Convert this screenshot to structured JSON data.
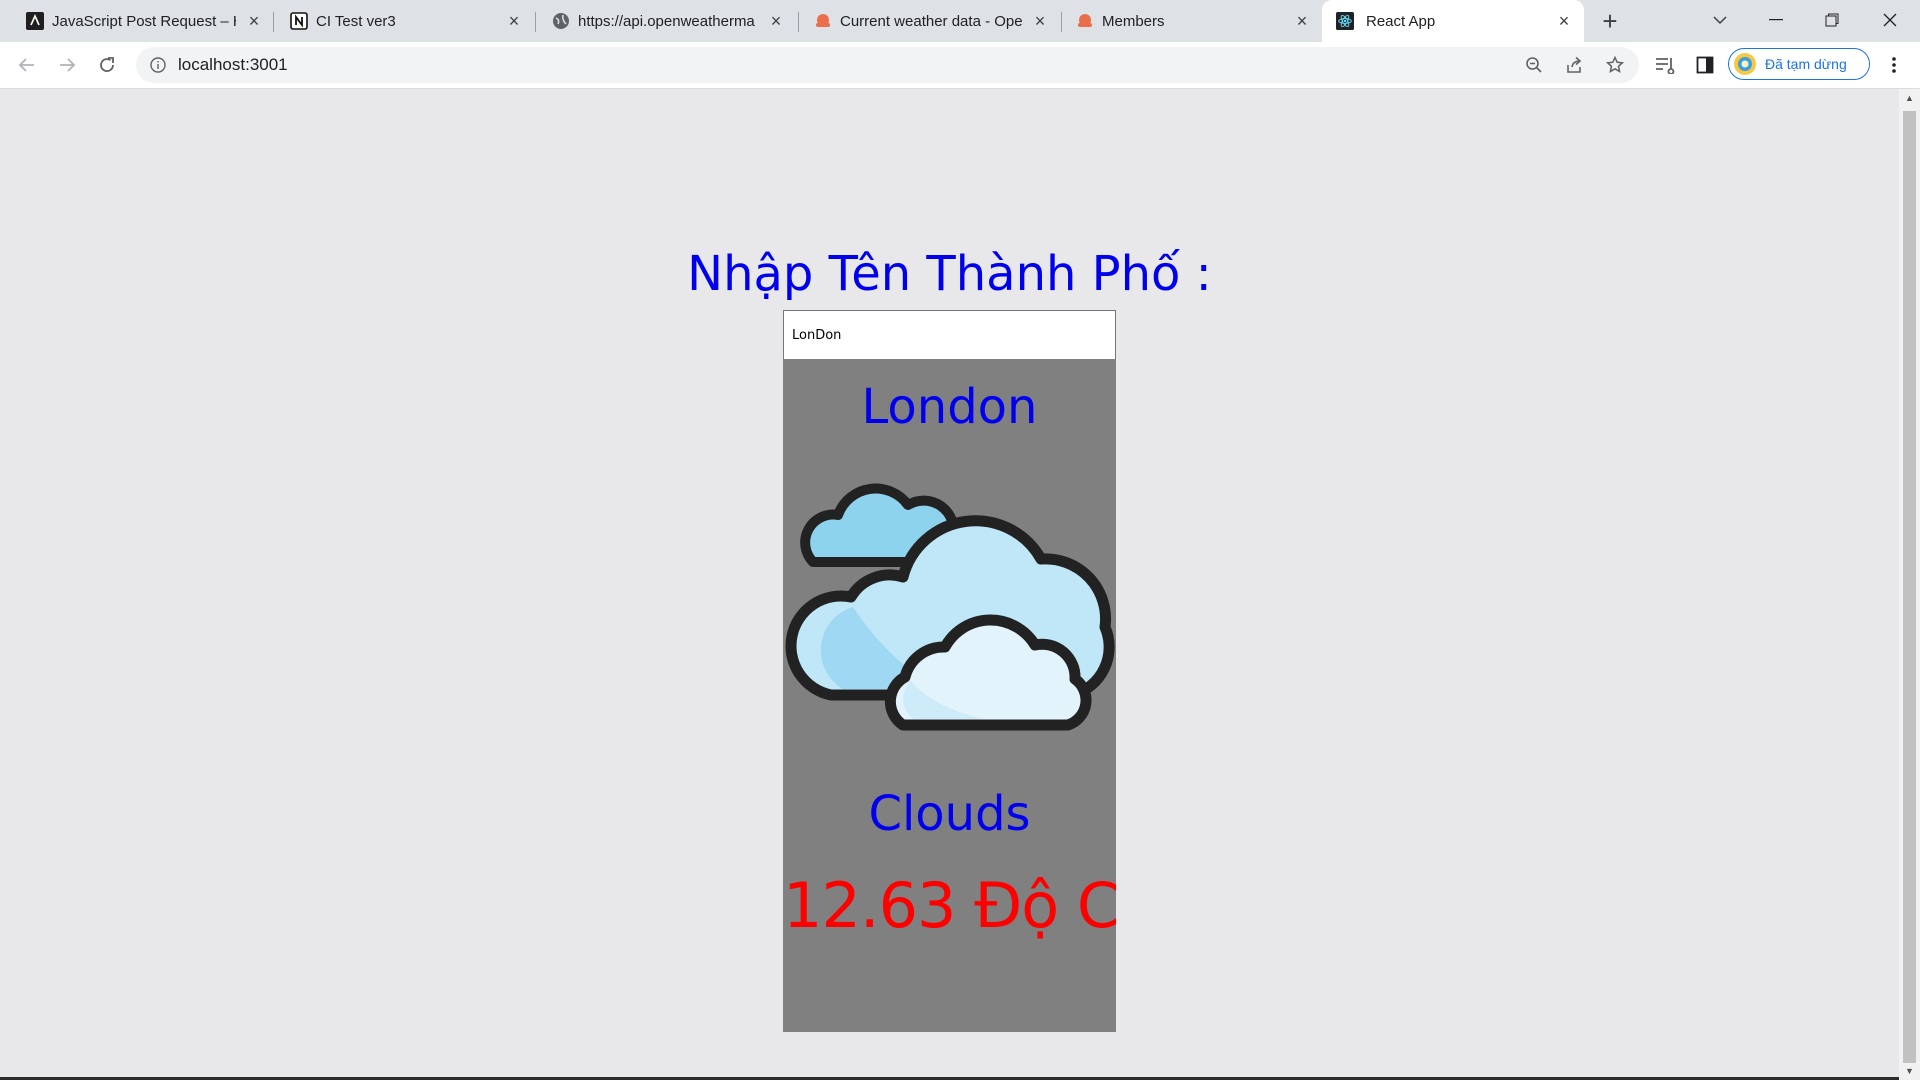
{
  "browser": {
    "tabs": [
      {
        "title": "JavaScript Post Request – H",
        "icon": "code-editor-icon",
        "active": false
      },
      {
        "title": "CI Test ver3",
        "icon": "notion-icon",
        "active": false
      },
      {
        "title": "https://api.openweatherma",
        "icon": "globe-icon",
        "active": false
      },
      {
        "title": "Current weather data - Ope",
        "icon": "openweather-icon",
        "active": false
      },
      {
        "title": "Members",
        "icon": "openweather-icon",
        "active": false
      },
      {
        "title": "React App",
        "icon": "react-icon",
        "active": true
      }
    ],
    "new_tab_label": "+",
    "url": "localhost:3001",
    "profile_label": "Đã tạm dừng"
  },
  "page": {
    "heading": "Nhập Tên Thành Phố :",
    "input_value": "LonDon",
    "city": "London",
    "weather_icon": "cloudy-icon",
    "condition": "Clouds",
    "temperature": "12.63 Độ C"
  },
  "colors": {
    "heading": "#0000ee",
    "temperature": "#ff0000",
    "card_bg": "#808080",
    "page_bg": "#e8e7ea"
  }
}
